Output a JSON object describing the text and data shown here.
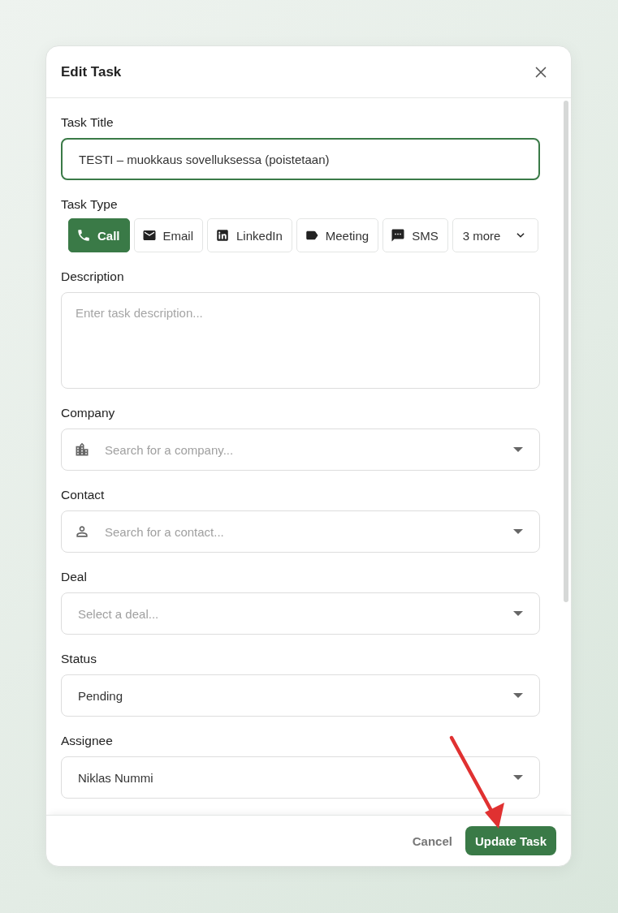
{
  "dialog": {
    "title": "Edit Task"
  },
  "fields": [
    {
      "kind": "text",
      "label": "Task Title",
      "value": "TESTI – muokkaus sovelluksessa (poistetaan)",
      "focused": true
    },
    {
      "kind": "chips",
      "label": "Task Type",
      "options": [
        {
          "label": "Call",
          "selected": true
        },
        {
          "label": "Email",
          "selected": false
        },
        {
          "label": "LinkedIn",
          "selected": false
        },
        {
          "label": "Meeting",
          "selected": false
        },
        {
          "label": "SMS",
          "selected": false
        }
      ],
      "more": "3 more"
    },
    {
      "kind": "textarea",
      "label": "Description",
      "placeholder": "Enter task description..."
    },
    {
      "kind": "search",
      "label": "Company",
      "placeholder": "Search for a company..."
    },
    {
      "kind": "search",
      "label": "Contact",
      "placeholder": "Search for a contact..."
    },
    {
      "kind": "select",
      "label": "Deal",
      "placeholder": "Select a deal..."
    },
    {
      "kind": "select",
      "label": "Status",
      "value": "Pending"
    },
    {
      "kind": "select",
      "label": "Assignee",
      "value": "Niklas Nummi"
    }
  ],
  "footer": {
    "buttons": [
      {
        "kind": "text",
        "label": "Cancel"
      },
      {
        "kind": "primary",
        "label": "Update Task"
      }
    ]
  }
}
